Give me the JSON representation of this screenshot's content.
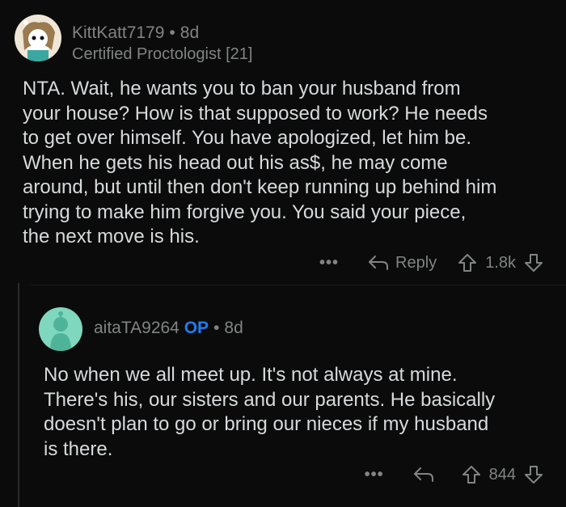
{
  "comment1": {
    "username": "KittKatt7179",
    "age": "8d",
    "flair": "Certified Proctologist [21]",
    "body": "NTA.  Wait, he wants you to ban your husband from\nyour house?  How is that supposed to work?  He needs\nto get over himself.  You have apologized, let him be.\nWhen he gets his head out his as$, he may come\naround, but until then don't keep running up behind him\ntrying to make him forgive you.  You said your piece,\nthe next move is his.",
    "more_label": "•••",
    "reply_label": "Reply",
    "score": "1.8k"
  },
  "comment2": {
    "username": "aitaTA9264",
    "op_badge": "OP",
    "age": "8d",
    "body": "No when we all meet up. It's not always at mine.\nThere's his, our sisters and our parents. He basically\ndoesn't plan to go or bring our nieces if my husband\nis there.",
    "more_label": "•••",
    "score": "844"
  },
  "icons": [
    "avatar",
    "reply-arrow-icon",
    "upvote-icon",
    "downvote-icon",
    "more-icon"
  ],
  "colors": {
    "background": "#0b0b0b",
    "text": "#d7dadc",
    "meta": "#818384",
    "op": "#1e7df0",
    "avatar2_bg": "#7fd7bd"
  }
}
